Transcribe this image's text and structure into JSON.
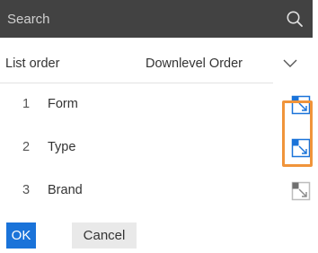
{
  "search": {
    "placeholder": "Search",
    "icon": "search-icon"
  },
  "header": {
    "list_order_label": "List order",
    "sort_select_label": "Downlevel Order",
    "sort_icon": "chevron-down-icon"
  },
  "list": {
    "items": [
      {
        "number": "1",
        "label": "Form",
        "toggle_state": "active",
        "toggle_icon": "expand-toggle-icon"
      },
      {
        "number": "2",
        "label": "Type",
        "toggle_state": "active",
        "toggle_icon": "expand-toggle-icon"
      },
      {
        "number": "3",
        "label": "Brand",
        "toggle_state": "inactive",
        "toggle_icon": "expand-toggle-icon"
      }
    ]
  },
  "highlight": {
    "color": "#f0943a"
  },
  "footer": {
    "ok_label": "OK",
    "cancel_label": "Cancel"
  },
  "colors": {
    "search_bar_bg": "#424242",
    "accent_blue": "#1a73d9",
    "toggle_active": "#1a73d9",
    "toggle_inactive": "#8a8a8a"
  }
}
